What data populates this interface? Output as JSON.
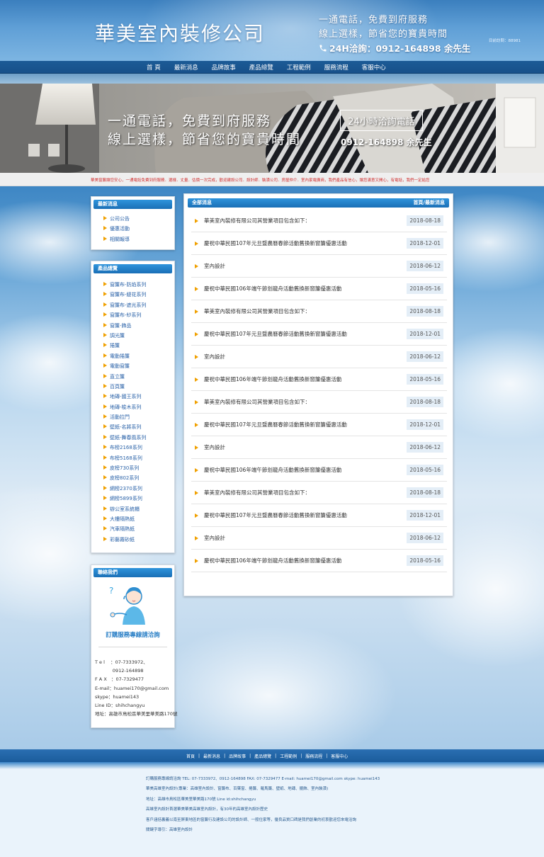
{
  "header": {
    "title": "華美室內裝修公司",
    "slogan_line1": "一通電話，免費到府服務",
    "slogan_line2": "線上選樣，節省您的寶貴時間",
    "hotline": "24H洽詢：0912-164898 余先生",
    "visit_counter": "目前訪問：88981"
  },
  "nav": {
    "items": [
      "首 頁",
      "最新消息",
      "品牌故事",
      "產品總覽",
      "工程範例",
      "服務流程",
      "客服中心"
    ]
  },
  "banner": {
    "line1": "一通電話，免費到府服務",
    "line2": "線上選樣，節省您的寶貴時間",
    "box_label": "24小時洽詢電話",
    "phone": "0912-164898 余先生"
  },
  "marquee": {
    "text": "華美窗簾讓您安心，一通電話免費到府服務．選樣．丈量．估價一次完成，歡迎建設公司．設計師．裝潢公司．房屋仲介．室內家電廣商，我們產品有信心，讓您滿意又開心，有電話，我們一定給您"
  },
  "sidebar": {
    "news": {
      "title": "最新消息",
      "items": [
        "公司公告",
        "優惠活動",
        "相關報導"
      ]
    },
    "products": {
      "title": "產品總覽",
      "items": [
        "窗簾布-防焰系列",
        "窗簾布-緹花系列",
        "窗簾布-遮光系列",
        "窗簾布-紗系列",
        "窗簾-飾品",
        "調光簾",
        "捲簾",
        "電動捲簾",
        "電動窗簾",
        "直立簾",
        "百頁簾",
        "地磚-國王系列",
        "地磚-梭木系列",
        "活動拉門",
        "壁紙-名將系列",
        "壁紙-舞春風系列",
        "布榜2168系列",
        "布榜5168系列",
        "皮榜730系列",
        "皮榜802系列",
        "網榜2370系列",
        "網榜5899系列",
        "辦公室系統櫃",
        "大樓隔熱紙",
        "汽車隔熱紙",
        "彩藝霧砂紙"
      ]
    },
    "contact": {
      "title": "聯絡我們",
      "cta": "訂購服務專線請洽詢",
      "lines": [
        "T e l    ：07-7333972、",
        "            0912-164898",
        "F A X   ：07-7329477",
        "E-mail：huamei170@gmail.com",
        "skype：huamei143",
        "Line ID：shihchangyu",
        "地址：高雄市鳥松區華美里華美路170號"
      ]
    }
  },
  "main": {
    "title": "全部消息",
    "right_link": "首頁/最新消息",
    "news": [
      {
        "title": "華美室內裝修有限公司其營業項目包含如下：",
        "date": "2018-08-18"
      },
      {
        "title": "慶祝中華民國107年元旦暨農曆春節活動舊換新窗簾優惠活動",
        "date": "2018-12-01"
      },
      {
        "title": "室內設計",
        "date": "2018-06-12"
      },
      {
        "title": "慶祝中華民國106年端午節划龍舟活動舊換新窗簾優惠活動",
        "date": "2018-05-16"
      },
      {
        "title": "華美室內裝修有限公司其營業項目包含如下：",
        "date": "2018-08-18"
      },
      {
        "title": "慶祝中華民國107年元旦暨農曆春節活動舊換新窗簾優惠活動",
        "date": "2018-12-01"
      },
      {
        "title": "室內設計",
        "date": "2018-06-12"
      },
      {
        "title": "慶祝中華民國106年端午節划龍舟活動舊換新窗簾優惠活動",
        "date": "2018-05-16"
      },
      {
        "title": "華美室內裝修有限公司其營業項目包含如下：",
        "date": "2018-08-18"
      },
      {
        "title": "慶祝中華民國107年元旦暨農曆春節活動舊換新窗簾優惠活動",
        "date": "2018-12-01"
      },
      {
        "title": "室內設計",
        "date": "2018-06-12"
      },
      {
        "title": "慶祝中華民國106年端午節划龍舟活動舊換新窗簾優惠活動",
        "date": "2018-05-16"
      },
      {
        "title": "華美室內裝修有限公司其營業項目包含如下：",
        "date": "2018-08-18"
      },
      {
        "title": "慶祝中華民國107年元旦暨農曆春節活動舊換新窗簾優惠活動",
        "date": "2018-12-01"
      },
      {
        "title": "室內設計",
        "date": "2018-06-12"
      },
      {
        "title": "慶祝中華民國106年端午節划龍舟活動舊換新窗簾優惠活動",
        "date": "2018-05-16"
      }
    ]
  },
  "footer": {
    "nav": [
      "首頁",
      "最新消息",
      "品牌故事",
      "產品總覽",
      "工程範例",
      "服務流程",
      "客服中心"
    ],
    "lines": [
      "訂購服務專線請洽詢 TEL: 07-7333972、0912-164898 FAX: 07-7329477   E-mail: huamei170@gmail.com    skype: huamei143",
      "華美高雄室內設計(專業：高雄室內設計、窗簾布、百葉窗、捲簾、羅馬簾、壁紙、地磚、擺飾、室內裝潢)",
      "地址：高雄市鳥松區華美里華美路170號  Line id:shihchangyu",
      "高雄室內設計首選華美華美高雄室內設計，有30年的高雄室內設計歷史",
      "客戶涵括裏義以南至屏東地區的窗簾行及建設公司的設計師、一般住家等，優良品質口碑是我們創業的初衷歡迎您來電洽詢",
      "關鍵字導引：高雄室內設計"
    ]
  }
}
